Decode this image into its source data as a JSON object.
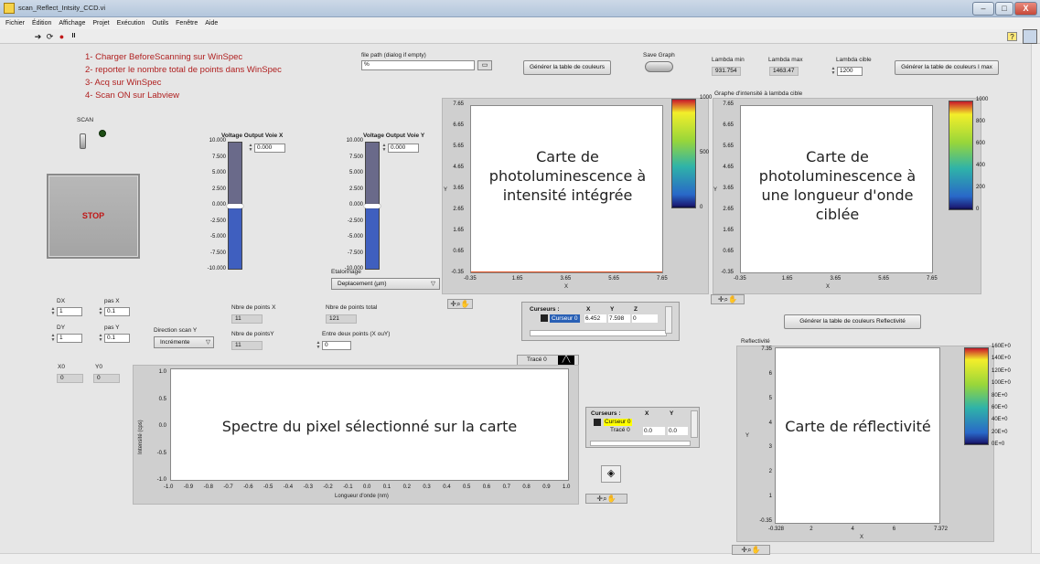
{
  "window": {
    "title": "scan_Reflect_Intsity_CCD.vi",
    "minimize": "–",
    "maximize": "□",
    "close": "X"
  },
  "menu": [
    "Fichier",
    "Édition",
    "Affichage",
    "Projet",
    "Exécution",
    "Outils",
    "Fenêtre",
    "Aide"
  ],
  "toolbar": {
    "run": "➔",
    "run_continuous": "⟳",
    "abort": "●",
    "pause": "II",
    "help": "?"
  },
  "instructions": [
    "1- Charger BeforeScanning sur WinSpec",
    "2- reporter le nombre total de points dans WinSpec",
    "3- Acq sur WinSpec",
    "4- Scan ON sur Labview"
  ],
  "scan": {
    "label": "SCAN"
  },
  "stop": {
    "label": "STOP"
  },
  "file_path": {
    "label": "file path (dialog if empty)",
    "value": "%"
  },
  "buttons": {
    "color_table": "Générer la table de couleurs",
    "color_table_imax": "Générer la table de couleurs I max",
    "color_table_refl": "Générer la table de couleurs Reflectivité"
  },
  "save_graph": {
    "label": "Save Graph"
  },
  "lambda": {
    "min_label": "Lambda min",
    "min_value": "931.754",
    "max_label": "Lambda max",
    "max_value": "1463.47",
    "cible_label": "Lambda cible",
    "cible_value": "1200"
  },
  "voltage_x": {
    "label": "Voltage Output Voie X",
    "value": "0.000",
    "level": 0.5,
    "ticks": [
      "10.000",
      "7.500",
      "5.000",
      "2.500",
      "0.000",
      "-2.500",
      "-5.000",
      "-7.500",
      "-10.000"
    ]
  },
  "voltage_y": {
    "label": "Voltage Output Voie Y",
    "value": "0.000",
    "level": 0.5,
    "ticks": [
      "10.000",
      "7.500",
      "5.000",
      "2.500",
      "0.000",
      "-2.500",
      "-5.000",
      "-7.500",
      "-10.000"
    ]
  },
  "etalonnage": {
    "label": "Etalonnage",
    "value": "Deplacement (µm)"
  },
  "map1": {
    "overlay": "Carte de photoluminescence à intensité intégrée",
    "yticks": [
      "7.65",
      "6.65",
      "5.65",
      "4.65",
      "3.65",
      "2.65",
      "1.65",
      "0.65",
      "-0.35"
    ],
    "xticks": [
      "-0.35",
      "1.65",
      "3.65",
      "5.65",
      "7.65"
    ],
    "xlabel": "X",
    "ylabel": "Y",
    "cticks": [
      "1000",
      "500",
      "0"
    ]
  },
  "map2": {
    "title": "Graphe d'intensité à lambda cible",
    "overlay": "Carte de photoluminescence à une longueur d'onde ciblée",
    "yticks": [
      "7.65",
      "6.65",
      "5.65",
      "4.65",
      "3.65",
      "2.65",
      "1.65",
      "0.65",
      "-0.35"
    ],
    "xticks": [
      "-0.35",
      "1.65",
      "3.65",
      "5.65",
      "7.65"
    ],
    "xlabel": "X",
    "ylabel": "Y",
    "cticks": [
      "1000",
      "800",
      "600",
      "400",
      "200",
      "0"
    ]
  },
  "cursor1": {
    "title": "Curseurs :",
    "cols": [
      "X",
      "Y",
      "Z"
    ],
    "name": "Curseur 0",
    "x": "6.452",
    "y": "7.598",
    "z": "0"
  },
  "dx": {
    "label": "DX",
    "value": "1"
  },
  "dy": {
    "label": "DY",
    "value": "1"
  },
  "pasx": {
    "label": "pas X",
    "value": "0.1"
  },
  "pasy": {
    "label": "pas Y",
    "value": "0.1"
  },
  "direction": {
    "label": "Direction scan Y",
    "value": "Incrémente"
  },
  "nbx": {
    "label": "Nbre de points X",
    "value": "11"
  },
  "nby": {
    "label": "Nbre de pointsY",
    "value": "11"
  },
  "nbtotal": {
    "label": "Nbre de points total",
    "value": "121"
  },
  "entre": {
    "label": "Entre deux points (X ouY)",
    "value": "0"
  },
  "x0": {
    "label": "X0",
    "value": "0"
  },
  "y0": {
    "label": "Y0",
    "value": "0"
  },
  "spectrum": {
    "legend": "Tracé 0",
    "overlay": "Spectre du pixel sélectionné sur la carte",
    "yticks": [
      "1.0",
      "0.5",
      "0.0",
      "-0.5",
      "-1.0"
    ],
    "xticks": [
      "-1.0",
      "-0.9",
      "-0.8",
      "-0.7",
      "-0.6",
      "-0.5",
      "-0.4",
      "-0.3",
      "-0.2",
      "-0.1",
      "0.0",
      "0.1",
      "0.2",
      "0.3",
      "0.4",
      "0.5",
      "0.6",
      "0.7",
      "0.8",
      "0.9",
      "1.0"
    ],
    "xlabel": "Longueur d'onde (nm)",
    "ylabel": "Intensité (cps)"
  },
  "cursor2": {
    "title": "Curseurs :",
    "cols": [
      "X",
      "Y"
    ],
    "name": "Curseur 0",
    "trace": "Tracé 0",
    "x": "0.0",
    "y": "0.0"
  },
  "refl": {
    "title": "Reflectivité",
    "overlay": "Carte de réflectivité",
    "yticks": [
      "7.35",
      "6",
      "5",
      "4",
      "3",
      "2",
      "1",
      "-0.35"
    ],
    "xticks": [
      "-0.328",
      "2",
      "4",
      "6",
      "7.372"
    ],
    "xlabel": "X",
    "ylabel": "Y",
    "cticks": [
      "160E+0",
      "140E+0",
      "120E+0",
      "100E+0",
      "80E+0",
      "60E+0",
      "40E+0",
      "20E+0",
      "0E+0"
    ]
  },
  "palette_icons": {
    "crosshair": "✛",
    "zoom": "⌕",
    "hand": "✋"
  }
}
